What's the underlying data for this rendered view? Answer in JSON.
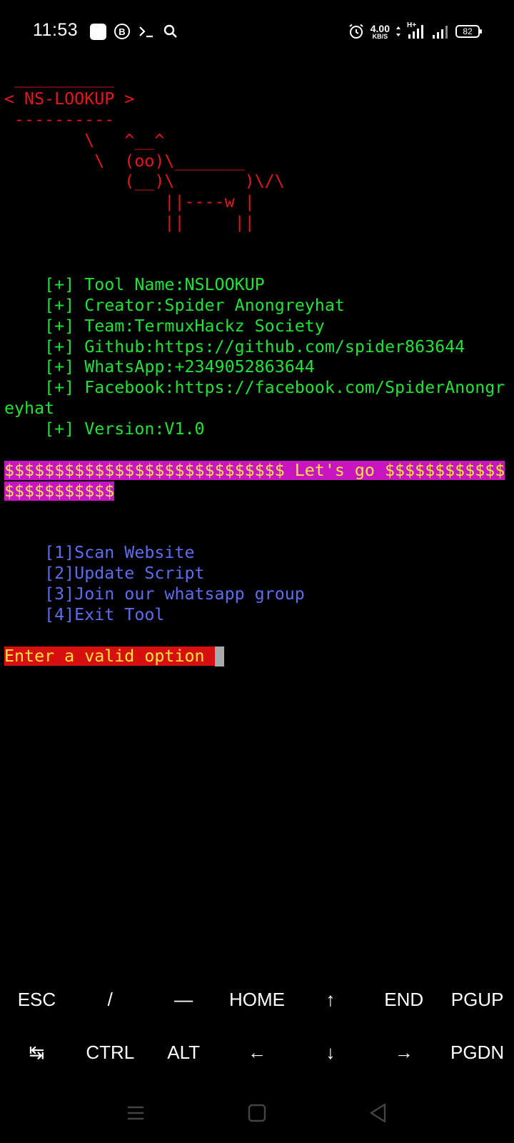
{
  "status_bar": {
    "time": "11:53",
    "net_speed_value": "4.00",
    "net_speed_unit": "KB/S",
    "network_type": "H+",
    "battery_level": "82",
    "icons": [
      "app-square-icon",
      "b-circle-icon",
      "terminal-icon",
      "search-icon",
      "alarm-icon",
      "data-arrows-icon",
      "signal-icon",
      "signal-icon-2",
      "battery-icon"
    ]
  },
  "terminal": {
    "cow": {
      "top_border": " __________",
      "title": "< NS-LOOKUP >",
      "bottom_border": " ----------",
      "art1": "        \\   ^__^",
      "art2": "         \\  (oo)\\_______",
      "art3": "            (__)\\       )\\/\\",
      "art4": "                ||----w |",
      "art5": "                ||     ||"
    },
    "info": {
      "tool_name": "    [+] Tool Name:NSLOOKUP",
      "creator": "    [+] Creator:Spider Anongreyhat",
      "team": "    [+] Team:TermuxHackz Society",
      "github": "    [+] Github:https://github.com/spider863644",
      "whatsapp": "    [+] WhatsApp:+2349052863644",
      "facebook_1": "    [+] Facebook:https://facebook.com/SpiderAnongr",
      "facebook_2": "eyhat",
      "version": "    [+] Version:V1.0"
    },
    "banner": {
      "line1": "$$$$$$$$$$$$$$$$$$$$$$$$$$$$ Let's go $$$$$$$$$$$$",
      "line2": "$$$$$$$$$$$"
    },
    "menu": {
      "opt1": "    [1]Scan Website",
      "opt2": "    [2]Update Script",
      "opt3": "    [3]Join our whatsapp group",
      "opt4": "    [4]Exit Tool"
    },
    "prompt": "Enter a valid option "
  },
  "extra_keys": {
    "row1": [
      "ESC",
      "/",
      "—",
      "HOME",
      "↑",
      "END",
      "PGUP"
    ],
    "row2": [
      "↹",
      "CTRL",
      "ALT",
      "←",
      "↓",
      "→",
      "PGDN"
    ]
  },
  "colors": {
    "background": "#000000",
    "red": "#e5161c",
    "green": "#20e337",
    "blue": "#5f6cf0",
    "magenta_bg": "#c716c1",
    "yellow_text": "#f7e542",
    "red_bg": "#d80f0f"
  }
}
